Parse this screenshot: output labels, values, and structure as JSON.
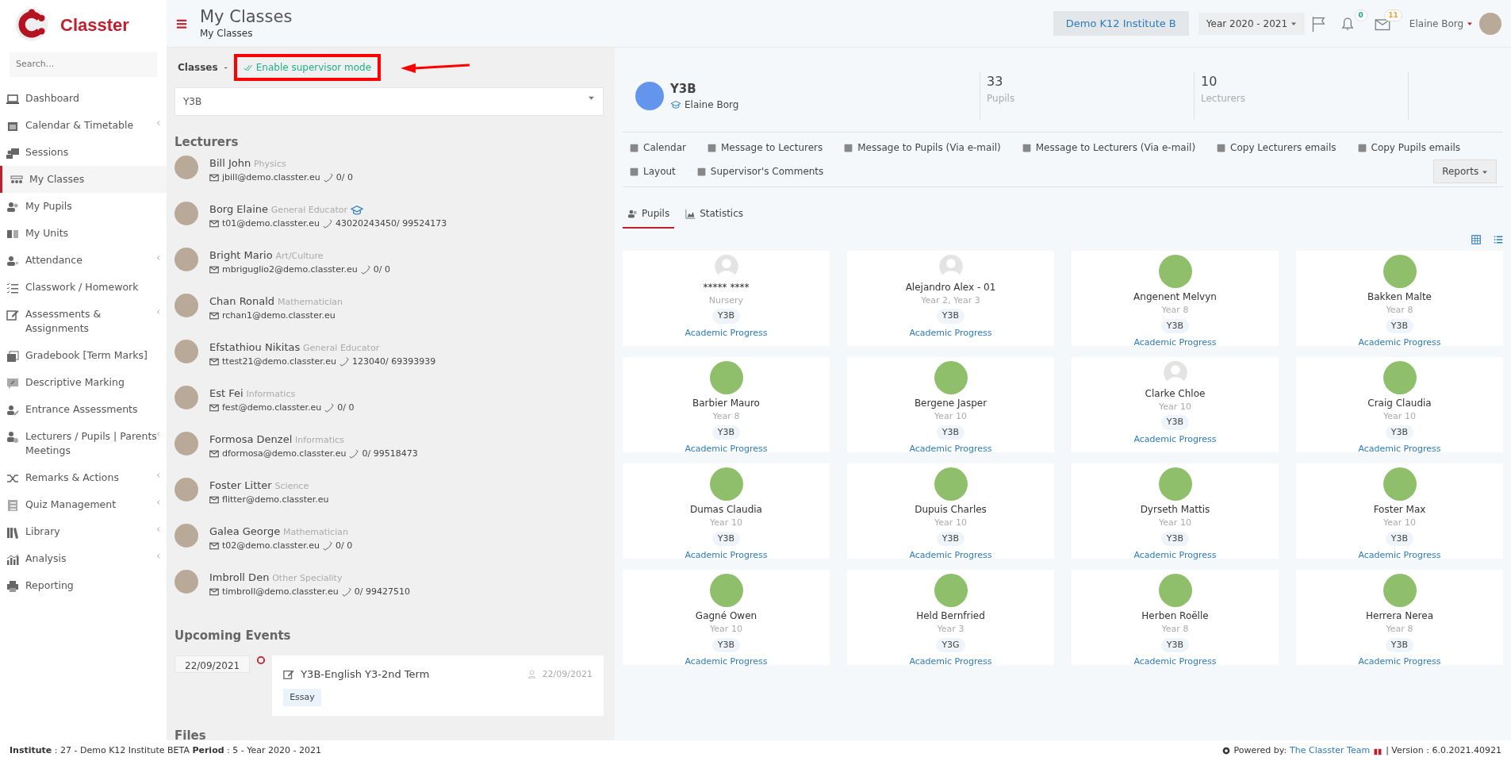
{
  "brand": {
    "name": "Classter"
  },
  "sidebar": {
    "search_placeholder": "Search...",
    "items": [
      {
        "label": "Dashboard",
        "has_submenu": false,
        "selected": false
      },
      {
        "label": "Calendar & Timetable",
        "has_submenu": true,
        "selected": false
      },
      {
        "label": "Sessions",
        "has_submenu": false,
        "selected": false
      },
      {
        "label": "My Classes",
        "has_submenu": false,
        "selected": true
      },
      {
        "label": "My Pupils",
        "has_submenu": false,
        "selected": false
      },
      {
        "label": "My Units",
        "has_submenu": false,
        "selected": false
      },
      {
        "label": "Attendance",
        "has_submenu": true,
        "selected": false
      },
      {
        "label": "Classwork / Homework",
        "has_submenu": false,
        "selected": false
      },
      {
        "label": "Assessments & Assignments",
        "has_submenu": true,
        "selected": false
      },
      {
        "label": "Gradebook [Term Marks]",
        "has_submenu": false,
        "selected": false
      },
      {
        "label": "Descriptive Marking",
        "has_submenu": false,
        "selected": false
      },
      {
        "label": "Entrance Assessments",
        "has_submenu": false,
        "selected": false
      },
      {
        "label": "Lecturers / Pupils | Parents Meetings",
        "has_submenu": true,
        "selected": false
      },
      {
        "label": "Remarks & Actions",
        "has_submenu": true,
        "selected": false
      },
      {
        "label": "Quiz Management",
        "has_submenu": true,
        "selected": false
      },
      {
        "label": "Library",
        "has_submenu": true,
        "selected": false
      },
      {
        "label": "Analysis",
        "has_submenu": true,
        "selected": false
      },
      {
        "label": "Reporting",
        "has_submenu": false,
        "selected": false
      }
    ]
  },
  "header": {
    "title": "My Classes",
    "breadcrumb": "My Classes",
    "institute": "Demo K12 Institute B",
    "year": "Year 2020 - 2021",
    "notifications": "0",
    "messages": "11",
    "user": "Elaine Borg"
  },
  "classes_panel": {
    "label": "Classes",
    "separator": "-",
    "supervisor_link": "Enable supervisor mode",
    "highlighted": true,
    "class_select": "Y3B",
    "lecturers_title": "Lecturers",
    "lecturers": [
      {
        "name": "Bill John",
        "specialty": "Physics",
        "email": "jbill@demo.classter.eu",
        "phone": "0/ 0",
        "supervisor": false
      },
      {
        "name": "Borg Elaine",
        "specialty": "General Educator",
        "email": "t01@demo.classter.eu",
        "phone": "43020243450/ 99524173",
        "supervisor": true
      },
      {
        "name": "Bright Mario",
        "specialty": "Art/Culture",
        "email": "mbriguglio2@demo.classter.eu",
        "phone": "0/ 0",
        "supervisor": false
      },
      {
        "name": "Chan Ronald",
        "specialty": "Mathematician",
        "email": "rchan1@demo.classter.eu",
        "supervisor": false
      },
      {
        "name": "Efstathiou Nikitas",
        "specialty": "General Educator",
        "email": "ttest21@demo.classter.eu",
        "phone": "123040/ 69393939",
        "supervisor": false
      },
      {
        "name": "Est Fei",
        "specialty": "Informatics",
        "email": "fest@demo.classter.eu",
        "phone": "0/ 0",
        "supervisor": false
      },
      {
        "name": "Formosa Denzel",
        "specialty": "Informatics",
        "email": "dformosa@demo.classter.eu",
        "phone": "0/ 99518473",
        "supervisor": false
      },
      {
        "name": "Foster Litter",
        "specialty": "Science",
        "email": "flitter@demo.classter.eu",
        "supervisor": false
      },
      {
        "name": "Galea George",
        "specialty": "Mathematician",
        "email": "t02@demo.classter.eu",
        "phone": "0/ 0",
        "supervisor": false
      },
      {
        "name": "Imbroll Den",
        "specialty": "Other Speciality",
        "email": "timbroll@demo.classter.eu",
        "phone": "0/ 99427510",
        "supervisor": false
      }
    ],
    "events_title": "Upcoming Events",
    "events": [
      {
        "date": "22/09/2021",
        "title": "Y3B-English Y3-2nd Term",
        "type": "Essay",
        "author_date": "22/09/2021"
      }
    ],
    "files_title": "Files"
  },
  "class_summary": {
    "name": "Y3B",
    "teacher": "Elaine Borg",
    "stats": [
      {
        "value": "33",
        "label": "Pupils"
      },
      {
        "value": "10",
        "label": "Lecturers"
      }
    ]
  },
  "actions": [
    "Calendar",
    "Message to Lecturers",
    "Message to Pupils (Via e-mail)",
    "Message to Lecturers (Via e-mail)",
    "Copy Lecturers emails",
    "Copy Pupils emails",
    "Layout",
    "Supervisor's Comments"
  ],
  "reports": "Reports",
  "tabs": [
    {
      "label": "Pupils",
      "selected": true
    },
    {
      "label": "Statistics",
      "selected": false
    }
  ],
  "pupils": [
    {
      "name": "***** ****",
      "year": "Nursery",
      "class": "Y3B",
      "link": "Academic Progress",
      "photo": false
    },
    {
      "name": "Alejandro Alex - 01",
      "year": "Year 2, Year 3",
      "class": "Y3B",
      "link": "Academic Progress",
      "photo": false
    },
    {
      "name": "Angenent Melvyn",
      "year": "Year 8",
      "class": "Y3B",
      "link": "Academic Progress",
      "photo": true
    },
    {
      "name": "Bakken Malte",
      "year": "Year 8",
      "class": "Y3B",
      "link": "Academic Progress",
      "photo": true
    },
    {
      "name": "Barbier Mauro",
      "year": "Year 8",
      "class": "Y3B",
      "link": "Academic Progress",
      "photo": true
    },
    {
      "name": "Bergene Jasper",
      "year": "Year 10",
      "class": "Y3B",
      "link": "Academic Progress",
      "photo": true
    },
    {
      "name": "Clarke Chloe",
      "year": "Year 10",
      "class": "Y3B",
      "link": "Academic Progress",
      "photo": false
    },
    {
      "name": "Craig Claudia",
      "year": "Year 10",
      "class": "Y3B",
      "link": "Academic Progress",
      "photo": true
    },
    {
      "name": "Dumas Claudia",
      "year": "Year 10",
      "class": "Y3B",
      "link": "Academic Progress",
      "photo": true
    },
    {
      "name": "Dupuis Charles",
      "year": "Year 10",
      "class": "Y3B",
      "link": "Academic Progress",
      "photo": true
    },
    {
      "name": "Dyrseth Mattis",
      "year": "Year 10",
      "class": "Y3B",
      "link": "Academic Progress",
      "photo": true
    },
    {
      "name": "Foster Max",
      "year": "Year 10",
      "class": "Y3B",
      "link": "Academic Progress",
      "photo": true
    },
    {
      "name": "Gagné Owen",
      "year": "Year 10",
      "class": "Y3B",
      "link": "Academic Progress",
      "photo": true
    },
    {
      "name": "Held Bernfried",
      "year": "Year 3",
      "class": "Y3G",
      "link": "Academic Progress",
      "photo": true
    },
    {
      "name": "Herben Roëlle",
      "year": "Year 8",
      "class": "Y3B",
      "link": "Academic Progress",
      "photo": true
    },
    {
      "name": "Herrera Nerea",
      "year": "Year 8",
      "class": "Y3B",
      "link": "Academic Progress",
      "photo": true
    }
  ],
  "footer": {
    "info": "**Institute** : 27 - Demo K12 Institute BETA **Period** : 5 - Year 2020 - 2021",
    "powered_by": "Powered by:",
    "team": "The Classter Team",
    "version": "| Version : 6.0.2021.40921"
  }
}
